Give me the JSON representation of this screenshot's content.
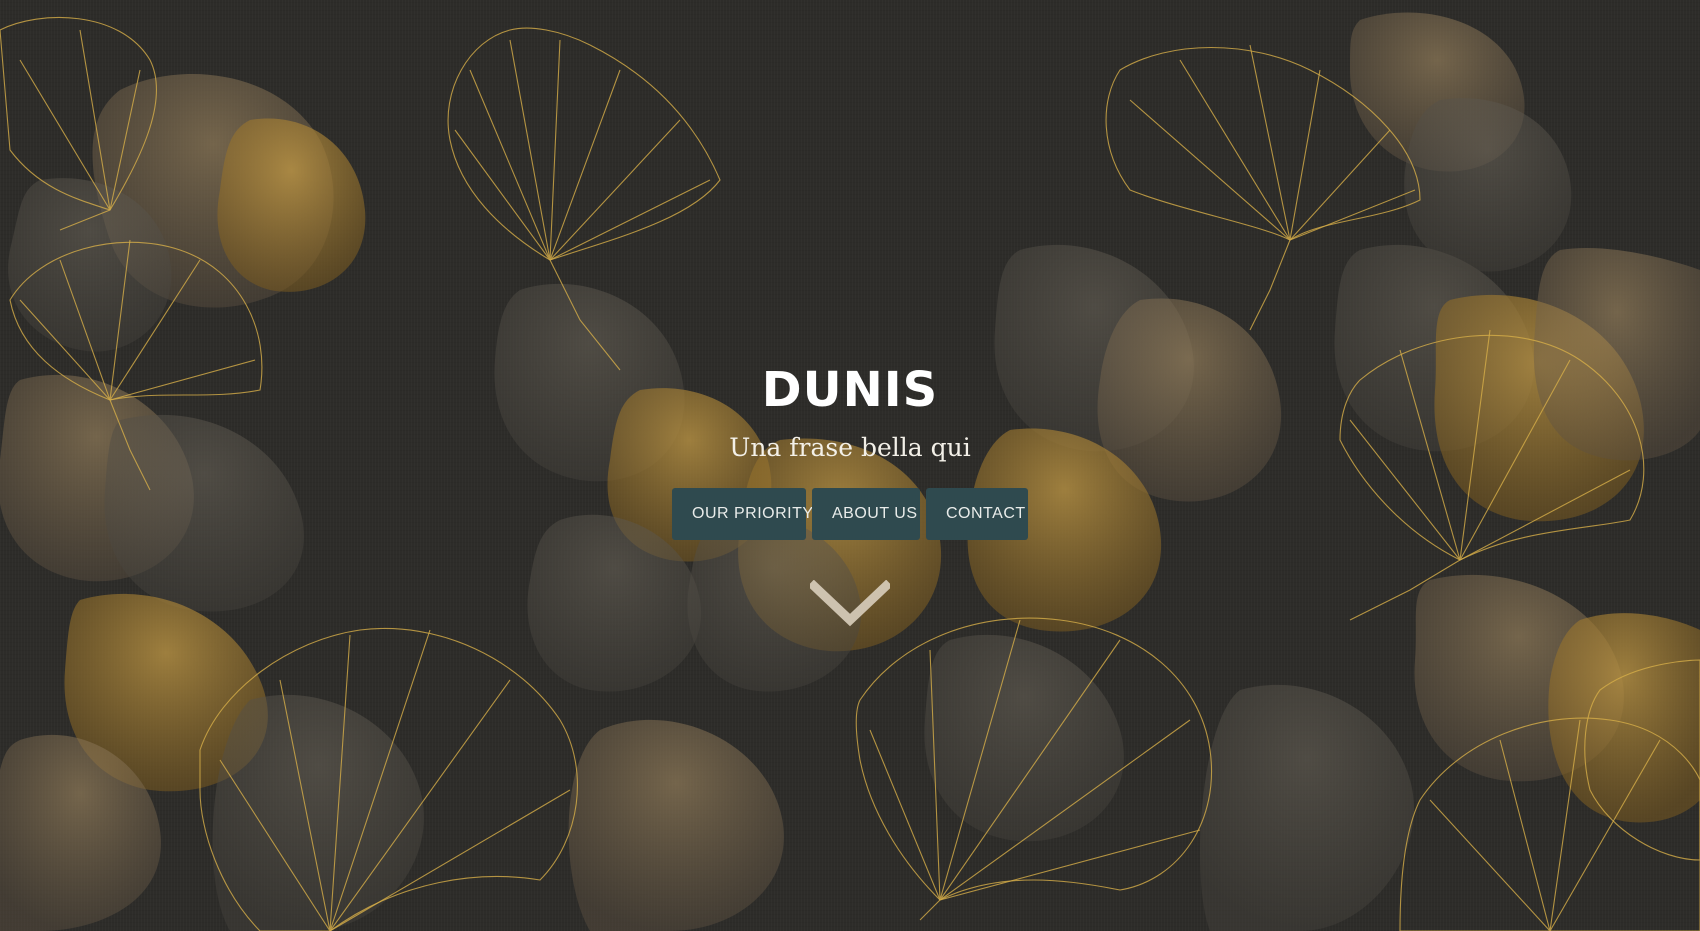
{
  "hero": {
    "title": "DUNIS",
    "subtitle": "Una frase bella qui"
  },
  "nav": {
    "items": [
      {
        "label": "OUR PRIORITY"
      },
      {
        "label": "ABOUT US"
      },
      {
        "label": "CONTACT"
      }
    ]
  },
  "scroll_indicator": {
    "icon": "chevron-down-icon"
  },
  "colors": {
    "background": "#2d2c29",
    "button_bg": "#2f4a4f",
    "leaf_gold": "#b88a2e",
    "leaf_line": "#d8b24a",
    "title_text": "#ffffff"
  }
}
